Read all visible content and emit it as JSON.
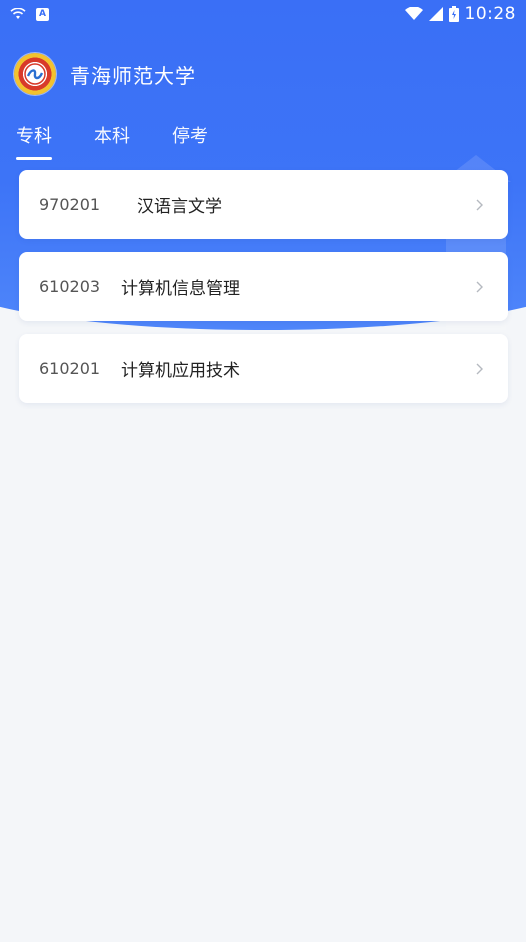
{
  "status_bar": {
    "time": "10:28",
    "left_icons": [
      "wifi-icon",
      "notification-a-icon"
    ],
    "right_icons": [
      "wifi-signal-icon",
      "cell-signal-icon",
      "battery-icon"
    ],
    "a_badge": "A"
  },
  "header": {
    "title": "青海师范大学",
    "logo_icon": "university-logo"
  },
  "tabs": [
    {
      "label": "专科",
      "active": true
    },
    {
      "label": "本科",
      "active": false
    },
    {
      "label": "停考",
      "active": false
    }
  ],
  "majors": [
    {
      "code": "970201",
      "name": "汉语言文学"
    },
    {
      "code": "610203",
      "name": "计算机信息管理"
    },
    {
      "code": "610201",
      "name": "计算机应用技术"
    }
  ],
  "colors": {
    "accent": "#3a6ff6",
    "background": "#f4f6f9",
    "card": "#ffffff"
  }
}
